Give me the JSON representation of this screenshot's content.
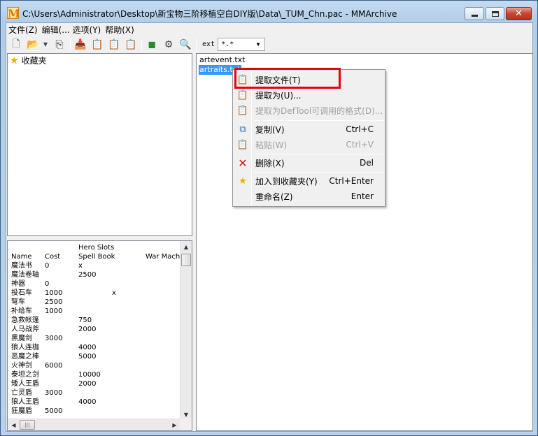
{
  "window": {
    "app_icon": "M",
    "title": "C:\\Users\\Administrator\\Desktop\\新宝物三阶移植空白DIY版\\Data\\_TUM_Chn.pac - MMArchive"
  },
  "menubar": {
    "items": [
      "文件(Z)",
      "编辑(... 选项(Y)",
      "帮助(X)"
    ]
  },
  "toolbar": {
    "icons": [
      "new-file-icon",
      "open-folder-icon",
      "dropdown-arrow-icon",
      "open-recent-icon",
      "add-files-icon",
      "extract-icon",
      "extract-as-icon",
      "extract-deftool-icon",
      "cube-icon",
      "settings-icon",
      "find-icon"
    ],
    "ext_label": "ext",
    "ext_filter": "*.*"
  },
  "favorites": {
    "label": "收藏夹"
  },
  "preview": {
    "header1": [
      "",
      "",
      "Hero Slots",
      "",
      ""
    ],
    "header2": [
      "Name",
      "Cost",
      "Spell Book",
      "",
      "War Mach"
    ],
    "rows": [
      [
        "魔法书",
        "0",
        "x",
        "",
        ""
      ],
      [
        "魔法卷轴",
        "",
        "2500",
        "",
        ""
      ],
      [
        "神器",
        "0",
        "",
        "",
        ""
      ],
      [
        "投石车",
        "1000",
        "",
        "x",
        ""
      ],
      [
        "弩车",
        "2500",
        "",
        "",
        ""
      ],
      [
        "补给车",
        "1000",
        "",
        "",
        ""
      ],
      [
        "急救帐篷",
        "",
        "750",
        "",
        ""
      ],
      [
        "人马战斧",
        "",
        "2000",
        "",
        ""
      ],
      [
        "黑魔剑",
        "3000",
        "",
        "",
        ""
      ],
      [
        "狼人连枷",
        "",
        "4000",
        "",
        ""
      ],
      [
        "恶魔之棒",
        "",
        "5000",
        "",
        ""
      ],
      [
        "火神剑",
        "6000",
        "",
        "",
        ""
      ],
      [
        "泰坦之剑",
        "",
        "10000",
        "",
        ""
      ],
      [
        "矮人王盾",
        "",
        "2000",
        "",
        ""
      ],
      [
        "亡灵盾",
        "3000",
        "",
        "",
        ""
      ],
      [
        "狼人王盾",
        "",
        "4000",
        "",
        ""
      ],
      [
        "狂魔盾",
        "5000",
        "",
        "",
        ""
      ]
    ]
  },
  "files": [
    {
      "name": "artevent.txt",
      "selected": false
    },
    {
      "name": "artraits.txt",
      "selected": true
    }
  ],
  "context_menu": {
    "items": [
      {
        "label": "提取文件(T)",
        "shortcut": "",
        "icon": "extract-file-icon",
        "disabled": false
      },
      {
        "label": "提取为(U)...",
        "shortcut": "",
        "icon": "extract-as-icon",
        "disabled": false
      },
      {
        "label": "提取为DefTool可调用的格式(D)...",
        "shortcut": "",
        "icon": "extract-deftool-icon",
        "disabled": true
      },
      {
        "label": "复制(V)",
        "shortcut": "Ctrl+C",
        "icon": "copy-icon",
        "disabled": false
      },
      {
        "label": "粘贴(W)",
        "shortcut": "Ctrl+V",
        "icon": "paste-icon",
        "disabled": true
      },
      {
        "label": "删除(X)",
        "shortcut": "Del",
        "icon": "delete-icon",
        "disabled": false
      },
      {
        "label": "加入到收藏夹(Y)",
        "shortcut": "Ctrl+Enter",
        "icon": "favorite-star-icon",
        "disabled": false
      },
      {
        "label": "重命名(Z)",
        "shortcut": "Enter",
        "icon": "",
        "disabled": false
      }
    ]
  },
  "colors": {
    "selection": "#3399ff",
    "highlight_box": "#e8000b"
  }
}
